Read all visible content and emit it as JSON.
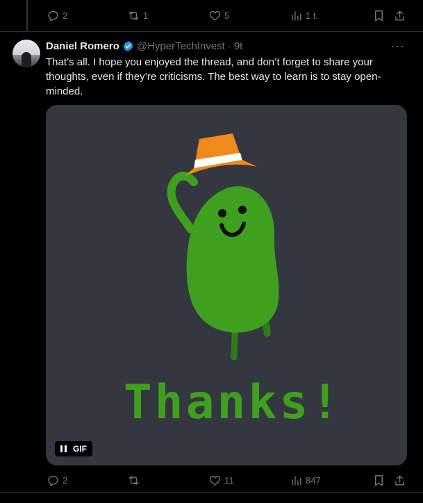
{
  "prev_tweet": {
    "reply_count": "2",
    "retweet_count": "1",
    "like_count": "5",
    "views_count": "1 t."
  },
  "tweet": {
    "author_name": "Daniel Romero",
    "author_handle": "@HyperTechInvest",
    "separator": "·",
    "time": "9t",
    "text": "That’s all. I hope you enjoyed the thread, and don’t forget to share your thoughts, even if they’re criticisms. The best way to learn is to stay open-minded.",
    "media": {
      "type": "GIF",
      "caption": "Thanks!",
      "gif_label": "GIF"
    },
    "reply_count": "2",
    "retweet_count": "",
    "like_count": "11",
    "views_count": "847"
  },
  "colors": {
    "background": "#000000",
    "text": "#e7e9ea",
    "muted": "#71767b",
    "verified": "#1d9bf0",
    "bean_green": "#3fa020",
    "hat_orange": "#f08a1c"
  },
  "icons": [
    "reply-icon",
    "retweet-icon",
    "like-icon",
    "views-icon",
    "bookmark-icon",
    "share-icon",
    "verified-badge-icon",
    "more-icon",
    "pause-icon"
  ]
}
